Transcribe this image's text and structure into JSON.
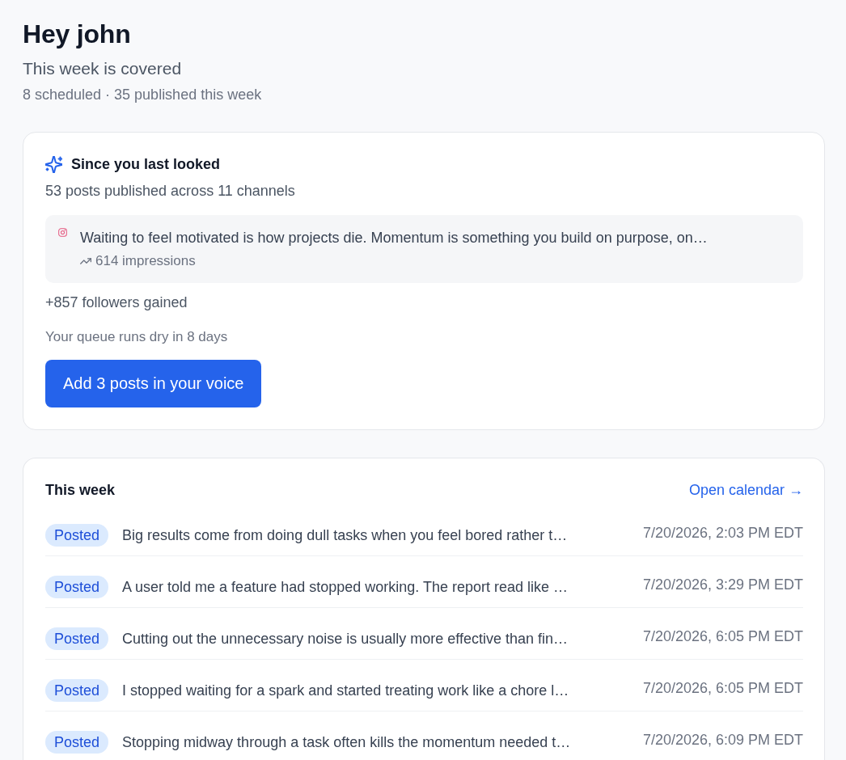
{
  "header": {
    "title": "Hey john",
    "subtitle": "This week is covered",
    "stats": "8 scheduled · 35 published this week"
  },
  "since_last_looked": {
    "title": "Since you last looked",
    "summary": "53 posts published across 11 channels",
    "top_post": {
      "text": "Waiting to feel motivated is how projects die. Momentum is something you build on purpose, on…",
      "impressions": "614 impressions"
    },
    "followers": "+857 followers gained",
    "queue_note": "Your queue runs dry in 8 days",
    "button": "Add 3 posts in your voice"
  },
  "this_week": {
    "title": "This week",
    "link": "Open calendar →",
    "posts": [
      {
        "status": "Posted",
        "text": "Big results come from doing dull tasks when you feel bored rather t…",
        "time": "7/20/2026, 2:03 PM EDT"
      },
      {
        "status": "Posted",
        "text": "A user told me a feature had stopped working. The report read like …",
        "time": "7/20/2026, 3:29 PM EDT"
      },
      {
        "status": "Posted",
        "text": "Cutting out the unnecessary noise is usually more effective than fin…",
        "time": "7/20/2026, 6:05 PM EDT"
      },
      {
        "status": "Posted",
        "text": "I stopped waiting for a spark and started treating work like a chore l…",
        "time": "7/20/2026, 6:05 PM EDT"
      },
      {
        "status": "Posted",
        "text": "Stopping midway through a task often kills the momentum needed t…",
        "time": "7/20/2026, 6:09 PM EDT"
      }
    ]
  }
}
